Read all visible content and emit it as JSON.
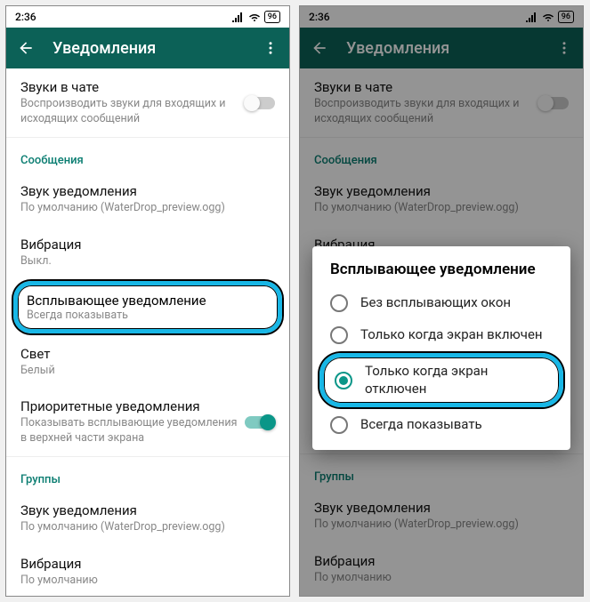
{
  "status": {
    "time": "2:36",
    "battery": "96"
  },
  "appbar": {
    "title": "Уведомления"
  },
  "left": {
    "chatSounds": {
      "label": "Звуки в чате",
      "sub": "Воспроизводить звуки для входящих и исходящих сообщений"
    },
    "secMessages": "Сообщения",
    "sound": {
      "label": "Звук уведомления",
      "sub": "По умолчанию (WaterDrop_preview.ogg)"
    },
    "vibration": {
      "label": "Вибрация",
      "sub": "Выкл."
    },
    "popup": {
      "label": "Всплывающее уведомление",
      "sub": "Всегда показывать"
    },
    "light": {
      "label": "Свет",
      "sub": "Белый"
    },
    "priority": {
      "label": "Приоритетные уведомления",
      "sub": "Показывать всплывающие уведомления в верхней части экрана"
    },
    "secGroups": "Группы",
    "gsound": {
      "label": "Звук уведомления",
      "sub": "По умолчанию (WaterDrop_preview.ogg)"
    },
    "gvibration": {
      "label": "Вибрация",
      "sub": "По умолчанию"
    }
  },
  "dialog": {
    "title": "Всплывающее уведомление",
    "opt1": "Без всплывающих окон",
    "opt2": "Только когда экран включен",
    "opt3": "Только когда экран отключен",
    "opt4": "Всегда показывать"
  }
}
